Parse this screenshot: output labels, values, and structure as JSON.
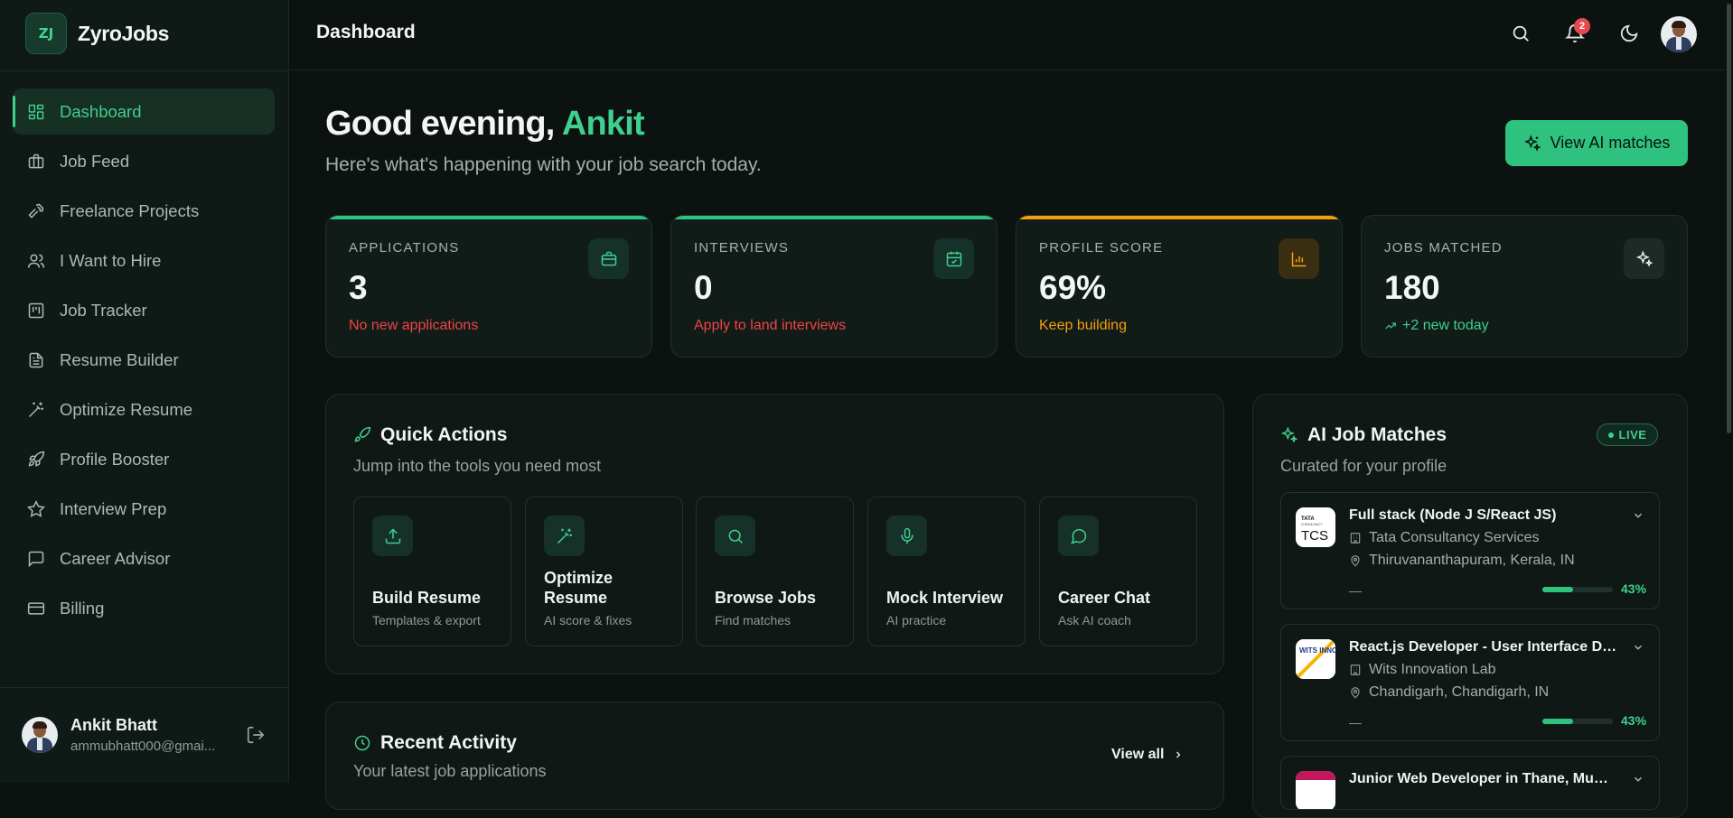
{
  "brand": {
    "logo_text": "ZJ",
    "name": "ZyroJobs"
  },
  "sidebar": {
    "items": [
      {
        "label": "Dashboard",
        "icon": "dashboard-icon",
        "active": true
      },
      {
        "label": "Job Feed",
        "icon": "briefcase-icon"
      },
      {
        "label": "Freelance Projects",
        "icon": "hammer-icon"
      },
      {
        "label": "I Want to Hire",
        "icon": "users-icon"
      },
      {
        "label": "Job Tracker",
        "icon": "kanban-icon"
      },
      {
        "label": "Resume Builder",
        "icon": "file-text-icon"
      },
      {
        "label": "Optimize Resume",
        "icon": "magic-wand-icon"
      },
      {
        "label": "Profile Booster",
        "icon": "rocket-icon"
      },
      {
        "label": "Interview Prep",
        "icon": "star-icon"
      },
      {
        "label": "Career Advisor",
        "icon": "message-square-icon"
      },
      {
        "label": "Billing",
        "icon": "credit-card-icon"
      }
    ],
    "user": {
      "name": "Ankit Bhatt",
      "email": "ammubhatt000@gmai..."
    }
  },
  "header": {
    "title": "Dashboard",
    "notification_count": "2"
  },
  "greeting": {
    "prefix": "Good evening, ",
    "name": "Ankit",
    "subtitle": "Here's what's happening with your job search today."
  },
  "cta": {
    "label": "View AI matches"
  },
  "stats": [
    {
      "label": "APPLICATIONS",
      "value": "3",
      "sub": "No new applications",
      "accent": "#2ec27e",
      "sub_color": "#ef4444",
      "icon": "briefcase-icon"
    },
    {
      "label": "INTERVIEWS",
      "value": "0",
      "sub": "Apply to land interviews",
      "accent": "#2ec27e",
      "sub_color": "#ef4444",
      "icon": "calendar-check-icon"
    },
    {
      "label": "PROFILE SCORE",
      "value": "69%",
      "sub": "Keep building",
      "accent": "#f59e0b",
      "sub_color": "#f59e0b",
      "icon": "bar-chart-icon"
    },
    {
      "label": "JOBS MATCHED",
      "value": "180",
      "sub": "+2 new today",
      "accent": "",
      "sub_color": "#3fcf8e",
      "icon": "sparkles-icon"
    }
  ],
  "quick_actions": {
    "title": "Quick Actions",
    "subtitle": "Jump into the tools you need most",
    "items": [
      {
        "title": "Build Resume",
        "sub": "Templates & export",
        "icon": "upload-icon"
      },
      {
        "title": "Optimize Resume",
        "sub": "AI score & fixes",
        "icon": "magic-wand-icon"
      },
      {
        "title": "Browse Jobs",
        "sub": "Find matches",
        "icon": "search-icon"
      },
      {
        "title": "Mock Interview",
        "sub": "AI practice",
        "icon": "mic-icon"
      },
      {
        "title": "Career Chat",
        "sub": "Ask AI coach",
        "icon": "chat-bubble-icon"
      }
    ]
  },
  "ai_matches": {
    "title": "AI Job Matches",
    "subtitle": "Curated for your profile",
    "live_label": "LIVE",
    "jobs": [
      {
        "title": "Full stack (Node J S/React JS)",
        "company": "Tata Consultancy Services",
        "location": "Thiruvananthapuram, Kerala, IN",
        "dash": "—",
        "match": 0.43,
        "match_label": "43%",
        "logo": "TCS"
      },
      {
        "title": "React.js Developer - User Interface Deve...",
        "company": "Wits Innovation Lab",
        "location": "Chandigarh, Chandigarh, IN",
        "dash": "—",
        "match": 0.43,
        "match_label": "43%",
        "logo": "WITS INNOVATION LAB"
      },
      {
        "title": "Junior Web Developer in Thane, Mumbai..."
      }
    ]
  },
  "recent_activity": {
    "title": "Recent Activity",
    "subtitle": "Your latest job applications",
    "view_all": "View all"
  }
}
